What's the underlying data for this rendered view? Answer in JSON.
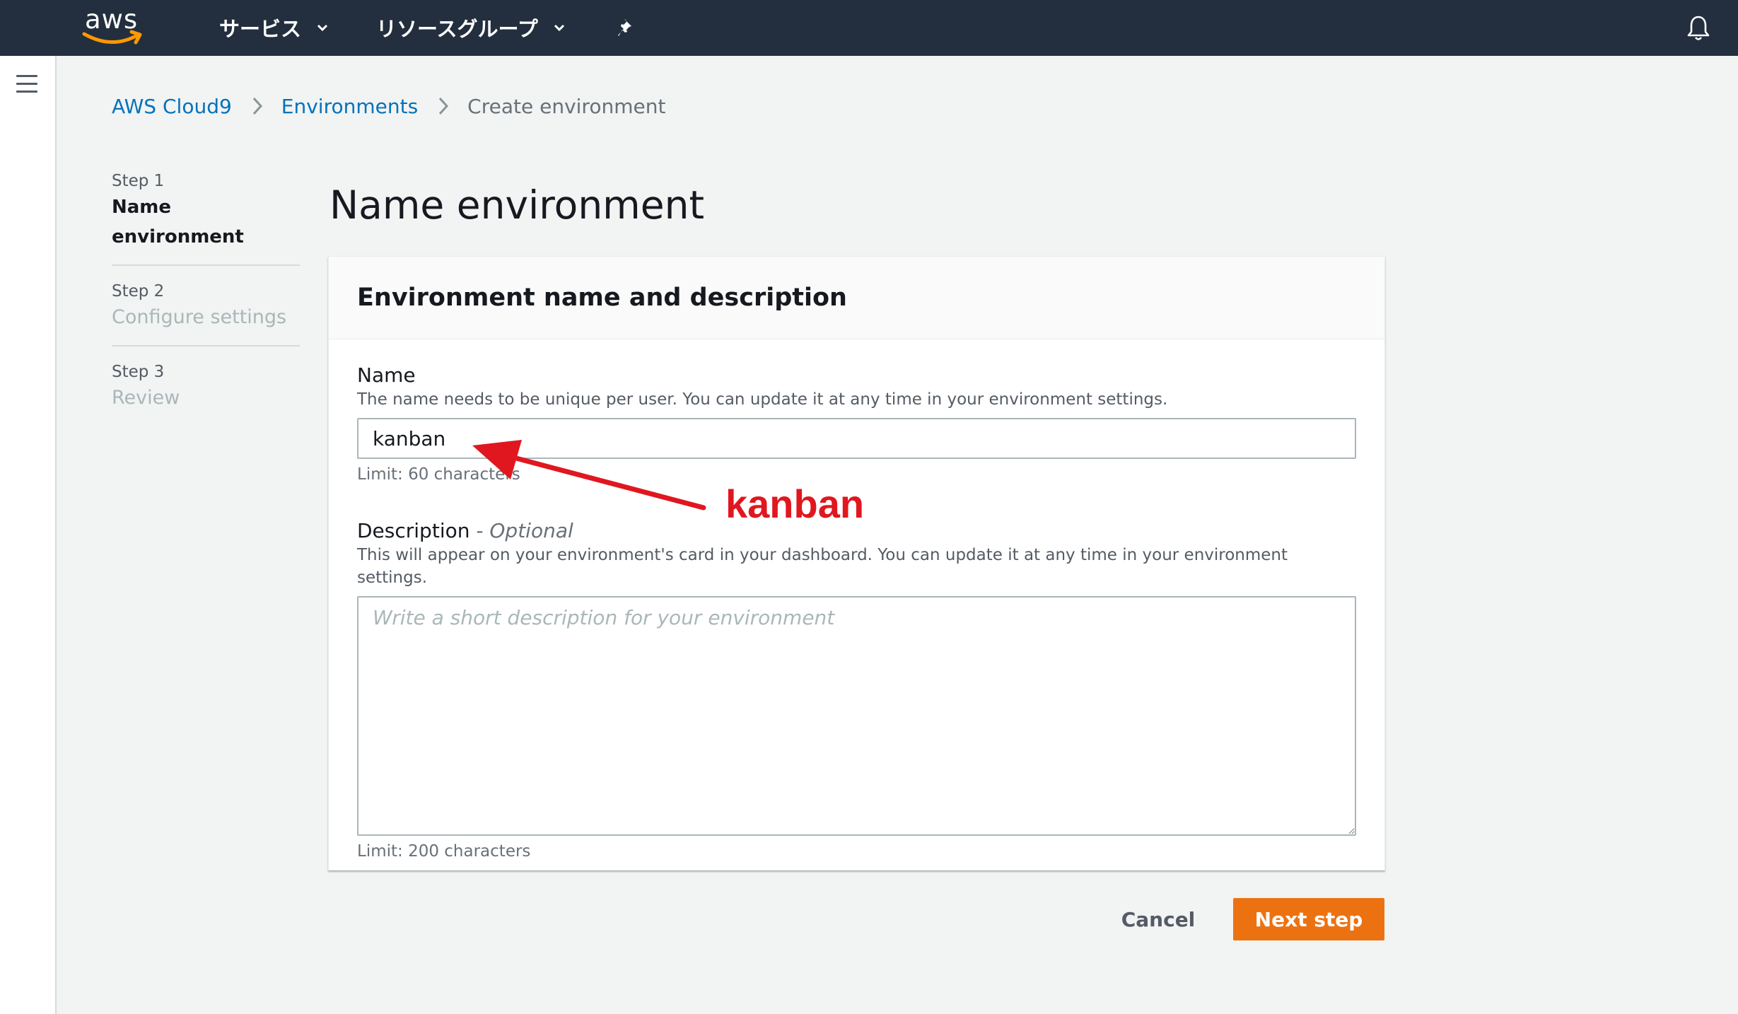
{
  "header": {
    "logo_text": "aws",
    "services_label": "サービス",
    "resource_groups_label": "リソースグループ"
  },
  "breadcrumb": {
    "items": [
      "AWS Cloud9",
      "Environments"
    ],
    "current": "Create environment"
  },
  "steps": [
    {
      "number": "Step 1",
      "title": "Name environment",
      "active": true
    },
    {
      "number": "Step 2",
      "title": "Configure settings",
      "active": false
    },
    {
      "number": "Step 3",
      "title": "Review",
      "active": false
    }
  ],
  "page_title": "Name environment",
  "section": {
    "title": "Environment name and description",
    "name_field": {
      "label": "Name",
      "description": "The name needs to be unique per user. You can update it at any time in your environment settings.",
      "value": "kanban",
      "hint": "Limit: 60 characters"
    },
    "description_field": {
      "label": "Description",
      "optional": "- Optional",
      "description": "This will appear on your environment's card in your dashboard. You can update it at any time in your environment settings.",
      "placeholder": "Write a short description for your environment",
      "hint": "Limit: 200 characters"
    }
  },
  "footer": {
    "cancel_label": "Cancel",
    "next_label": "Next step"
  },
  "annotation": {
    "text": "kanban",
    "color": "#e0171f"
  },
  "colors": {
    "topbar": "#232f3e",
    "link": "#0073bb",
    "primary_button": "#ec7211"
  }
}
